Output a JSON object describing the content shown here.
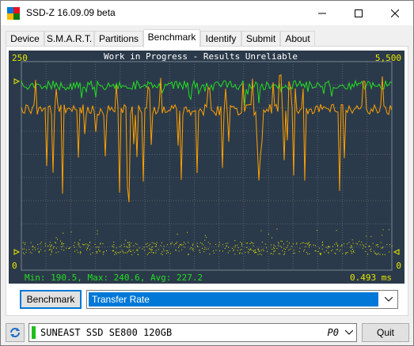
{
  "window": {
    "title": "SSD-Z 16.09.09 beta"
  },
  "tabs": [
    {
      "label": "Device"
    },
    {
      "label": "S.M.A.R.T."
    },
    {
      "label": "Partitions"
    },
    {
      "label": "Benchmark"
    },
    {
      "label": "Identify"
    },
    {
      "label": "Submit"
    },
    {
      "label": "About"
    }
  ],
  "graph": {
    "title": "Work in Progress - Results Unreliable",
    "left_max": "250",
    "right_max": "5,500",
    "left_min": "0",
    "right_min": "0",
    "stats": "Min: 190.5, Max: 240.6, Avg: 227.2",
    "latency": "0.493 ms",
    "colors": {
      "background": "#2b3a4a",
      "transfer": "#ffa000",
      "green": "#22dd22",
      "yellow": "#e6e600"
    }
  },
  "controls": {
    "benchmark_button": "Benchmark",
    "mode_select": "Transfer Rate"
  },
  "footer": {
    "drive_name": "SUNEAST SSD SE800 120GB",
    "drive_id": "P0",
    "quit_button": "Quit"
  },
  "icons": {
    "app": "app-icon",
    "refresh": "refresh-icon",
    "minimize": "minimize-icon",
    "maximize": "maximize-icon",
    "close": "close-icon",
    "dropdown": "chevron-down-icon"
  }
}
